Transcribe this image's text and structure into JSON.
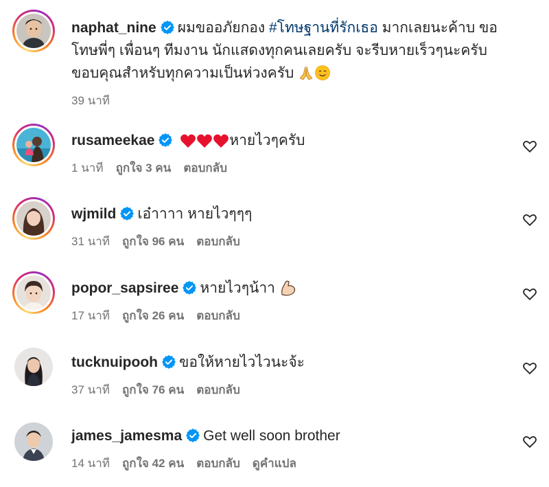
{
  "post": {
    "username": "naphat_nine",
    "caption_lines": [
      "ผมขออภัยกอง",
      "#โทษฐานที่รักเธอ",
      "มากเลยนะค้าบ ขอ",
      "โทษพี่ๆ เพื่อนๆ ทีมงาน นักแสดงทุกคนเลยครับ จะรีบหายเร็วๆนะครับ",
      "ขอบคุณสำหรับทุกความเป็นห่วงครับ"
    ],
    "time": "39 นาที"
  },
  "comments": [
    {
      "username": "rusameekae",
      "text": "หายไวๆครับ",
      "time": "1 นาที",
      "likes": "ถูกใจ 3 คน",
      "reply": "ตอบกลับ",
      "translate": ""
    },
    {
      "username": "wjmild",
      "text": "เอ๋าาาา หายไวๆๆๆ",
      "time": "31 นาที",
      "likes": "ถูกใจ 96 คน",
      "reply": "ตอบกลับ",
      "translate": ""
    },
    {
      "username": "popor_sapsiree",
      "text": "หายไวๆน้าา",
      "time": "17 นาที",
      "likes": "ถูกใจ 26 คน",
      "reply": "ตอบกลับ",
      "translate": ""
    },
    {
      "username": "tucknuipooh",
      "text": "ขอให้หายไวไวนะจ้ะ",
      "time": "37 นาที",
      "likes": "ถูกใจ 76 คน",
      "reply": "ตอบกลับ",
      "translate": ""
    },
    {
      "username": "james_jamesma",
      "text": "Get well soon brother",
      "time": "14 นาที",
      "likes": "ถูกใจ 42 คน",
      "reply": "ตอบกลับ",
      "translate": "ดูคำแปล"
    }
  ],
  "colors": {
    "text": "#262626",
    "muted": "#737373",
    "hashtag": "#00376b",
    "verified": "#0095f6"
  },
  "icons": [
    "verified-badge-icon",
    "heart-outline-icon",
    "red-heart-emoji",
    "folded-hands-emoji",
    "smiling-face-emoji",
    "flexed-biceps-emoji"
  ]
}
